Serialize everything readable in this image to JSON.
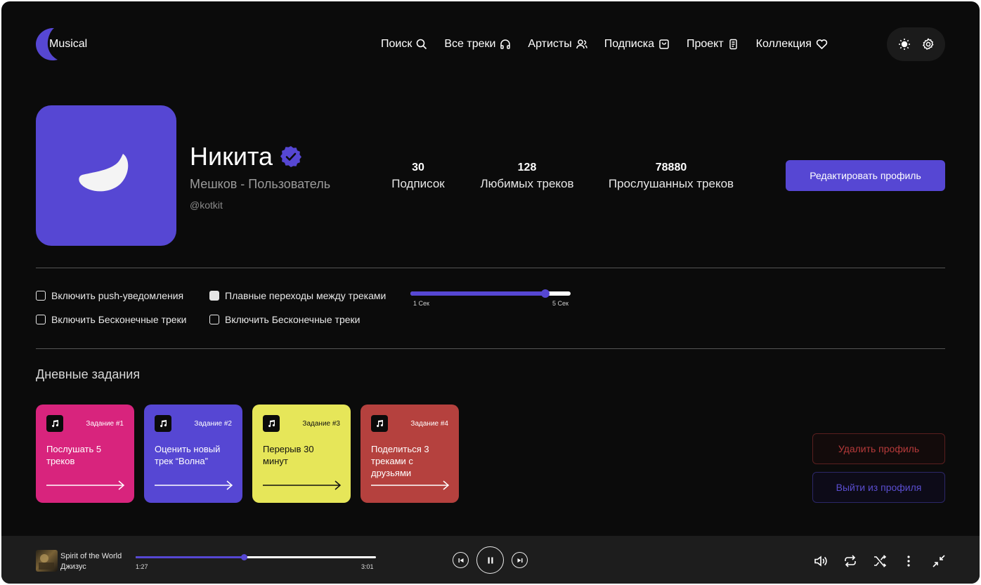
{
  "app": {
    "name": "Musical"
  },
  "nav": [
    {
      "label": "Поиск",
      "icon": "search-icon"
    },
    {
      "label": "Все треки",
      "icon": "headphones-icon"
    },
    {
      "label": "Артисты",
      "icon": "users-icon"
    },
    {
      "label": "Подписка",
      "icon": "shopping-bag-icon"
    },
    {
      "label": "Проект",
      "icon": "document-icon"
    },
    {
      "label": "Коллекция",
      "icon": "heart-icon"
    }
  ],
  "toolbar": {
    "theme_icon": "sun-icon",
    "settings_icon": "gear-icon"
  },
  "profile": {
    "name": "Никита",
    "subtitle": "Мешков - Пользователь",
    "handle": "@kotkit",
    "verified_icon": "verified-badge-icon",
    "accent": "#5647d3",
    "stats": [
      {
        "value": "30",
        "label": "Подписок"
      },
      {
        "value": "128",
        "label": "Любимых треков"
      },
      {
        "value": "78880",
        "label": "Прослушанных треков"
      }
    ],
    "edit_label": "Редактировать профиль"
  },
  "settings": {
    "checkboxes": [
      {
        "label": "Включить push-уведомления",
        "checked": false
      },
      {
        "label": "Плавные переходы между треками",
        "checked": true
      },
      {
        "label": "Включить Бесконечные треки",
        "checked": false
      },
      {
        "label": "Включить Бесконечные треки",
        "checked": false
      }
    ],
    "crossfade": {
      "min_label": "1 Сек",
      "max_label": "5 Сек",
      "value_fraction": 0.84
    }
  },
  "tasks": {
    "title": "Дневные задания",
    "items": [
      {
        "num": "Задание #1",
        "text": "Послушать 5 треков",
        "color": "#d8247d",
        "fg": "#ffffff"
      },
      {
        "num": "Задание #2",
        "text": "Оценить новый трек “Волна”",
        "color": "#5647d3",
        "fg": "#ffffff"
      },
      {
        "num": "Задание #3",
        "text": "Перерыв 30 минут",
        "color": "#e6e659",
        "fg": "#111111"
      },
      {
        "num": "Задание #4",
        "text": "Поделиться 3 треками с друзьями",
        "color": "#b5413e",
        "fg": "#ffffff"
      }
    ]
  },
  "account": {
    "delete_label": "Удалить профиль",
    "logout_label": "Выйти из профиля"
  },
  "player": {
    "track_title": "Spirit of the World",
    "artist": "Джизус",
    "current_time": "1:27",
    "total_time": "3:01",
    "progress_fraction": 0.45
  }
}
